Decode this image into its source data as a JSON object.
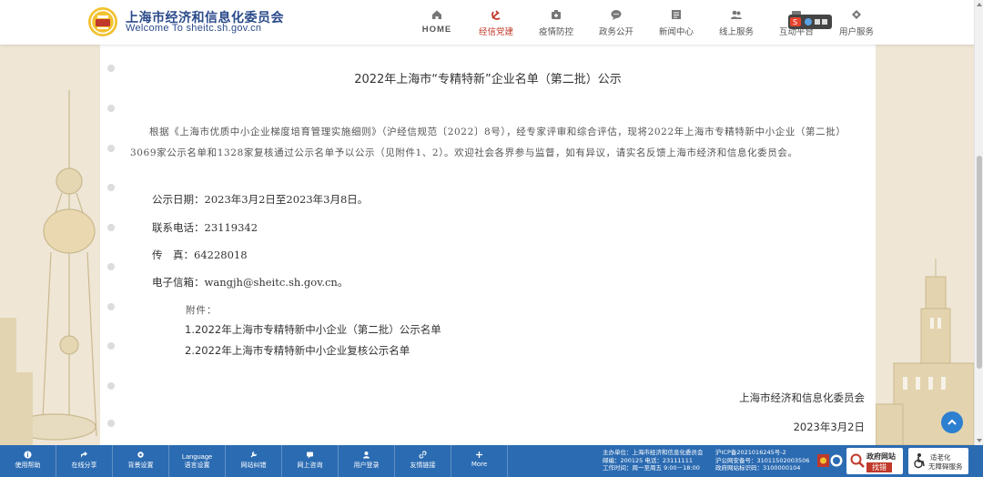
{
  "header": {
    "site_name_cn": "上海市经济和信息化委员会",
    "site_name_en": "Welcome To sheitc.sh.gov.cn",
    "nav": [
      {
        "id": "home",
        "label": "HOME"
      },
      {
        "id": "party",
        "label": "经信党建"
      },
      {
        "id": "epidemic",
        "label": "疫情防控"
      },
      {
        "id": "gov",
        "label": "政务公开"
      },
      {
        "id": "news",
        "label": "新闻中心"
      },
      {
        "id": "online",
        "label": "线上服务"
      },
      {
        "id": "interact",
        "label": "互动平台"
      },
      {
        "id": "user",
        "label": "用户服务"
      }
    ]
  },
  "article": {
    "title": "2022年上海市“专精特新”企业名单（第二批）公示",
    "body": "根据《上海市优质中小企业梯度培育管理实施细则》（沪经信规范〔2022〕8号），经专家评审和综合评估，现将2022年上海市专精特新中小企业（第二批）3069家公示名单和1328家复核通过公示名单予以公示（见附件1、2）。欢迎社会各界参与监督，如有异议，请实名反馈上海市经济和信息化委员会。",
    "period_label": "公示日期：",
    "period_value": "2023年3月2日至2023年3月8日。",
    "phone_label": "联系电话：",
    "phone_value": "23119342",
    "fax_label": "传　真：",
    "fax_value": "64228018",
    "email_label": "电子信箱：",
    "email_value": "wangjh@sheitc.sh.gov.cn。",
    "attachments_head": "附件：",
    "attachments": [
      "1.2022年上海市专精特新中小企业（第二批）公示名单",
      "2.2022年上海市专精特新中小企业复核公示名单"
    ],
    "signature": "上海市经济和信息化委员会",
    "date": "2023年3月2日"
  },
  "toolbar": {
    "tools": [
      {
        "top": "",
        "label": "使用帮助"
      },
      {
        "top": "",
        "label": "在线分享"
      },
      {
        "top": "",
        "label": "背景设置"
      },
      {
        "top": "Language",
        "label": "语言设置"
      },
      {
        "top": "",
        "label": "网站纠错"
      },
      {
        "top": "",
        "label": "网上咨询"
      },
      {
        "top": "",
        "label": "用户登录"
      },
      {
        "top": "",
        "label": "友情链接"
      },
      {
        "top": "",
        "label": "More"
      }
    ],
    "info_lines": [
      "主办单位：上海市经济和信息化委员会",
      "邮编：200125 电话：23111111",
      "工作时间：周一至周五 9:00－18:00"
    ],
    "info_lines_2": [
      "沪ICP备2021016245号-2",
      "沪公网安备号：31011502003506",
      "政府网站标识码：3100000104"
    ],
    "badge1": {
      "line1": "政府网站",
      "line2": "找错"
    },
    "badge2": {
      "line1": "适老化",
      "line2": "无障碍服务"
    }
  },
  "colors": {
    "brand_blue": "#2a4a8a",
    "toolbar_blue": "#2b6bb2",
    "active_red": "#c0392b",
    "background": "#efe6d6"
  }
}
